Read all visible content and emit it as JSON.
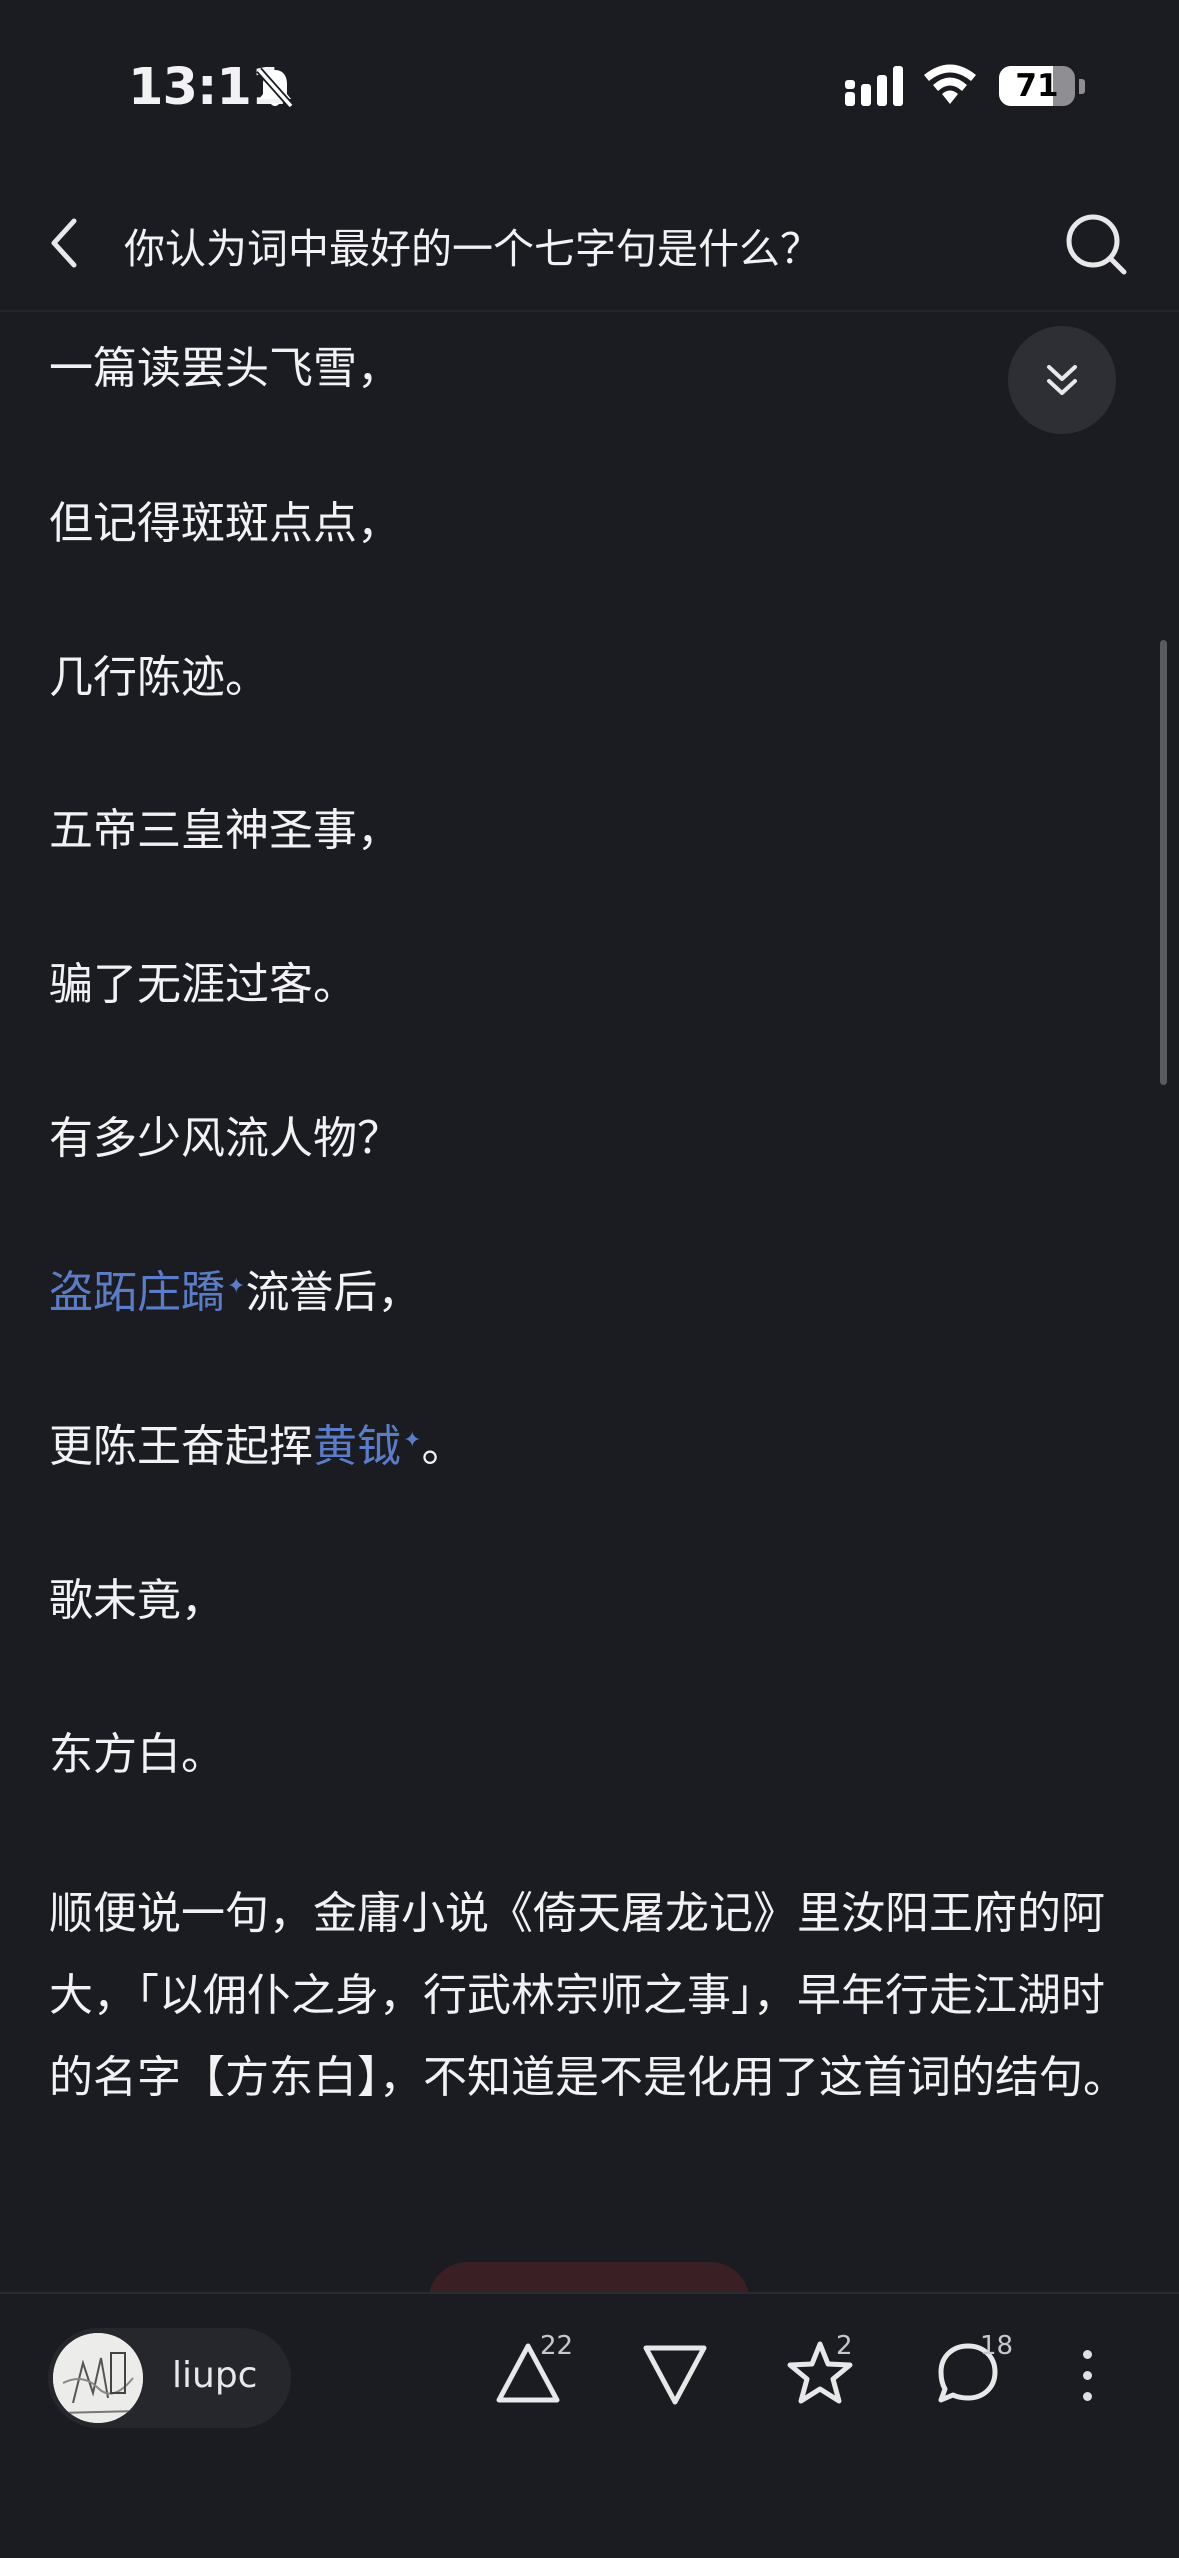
{
  "status_bar": {
    "time": "13:11",
    "battery": "71",
    "battery_level": 0.71
  },
  "nav": {
    "title": "你认为词中最好的一个七字句是什么？"
  },
  "content": {
    "lines": [
      "一篇读罢头飞雪，",
      "但记得斑斑点点，",
      "几行陈迹。",
      "五帝三皇神圣事，",
      "骗了无涯过客。",
      "有多少风流人物？"
    ],
    "line7_link": "盗跖庄蹻",
    "line7_rest": "流誉后，",
    "line8_pre": "更陈王奋起挥",
    "line8_link": "黄钺",
    "line8_rest": "。",
    "line9": "歌未竟，",
    "line10": "东方白。",
    "paragraph": "顺便说一句，金庸小说《倚天屠龙记》里汝阳王府的阿大，「以佣仆之身，行武林宗师之事」，早年行走江湖时的名字【方东白】，不知道是不是化用了这首词的结句。",
    "link_mark": "✦"
  },
  "bottom_bar": {
    "author": "liupc",
    "upvote_count": "22",
    "favorite_count": "2",
    "comment_count": "18"
  },
  "colors": {
    "background": "#1b1c21",
    "link": "#5b7cc6",
    "text": "#f2f2f4"
  }
}
